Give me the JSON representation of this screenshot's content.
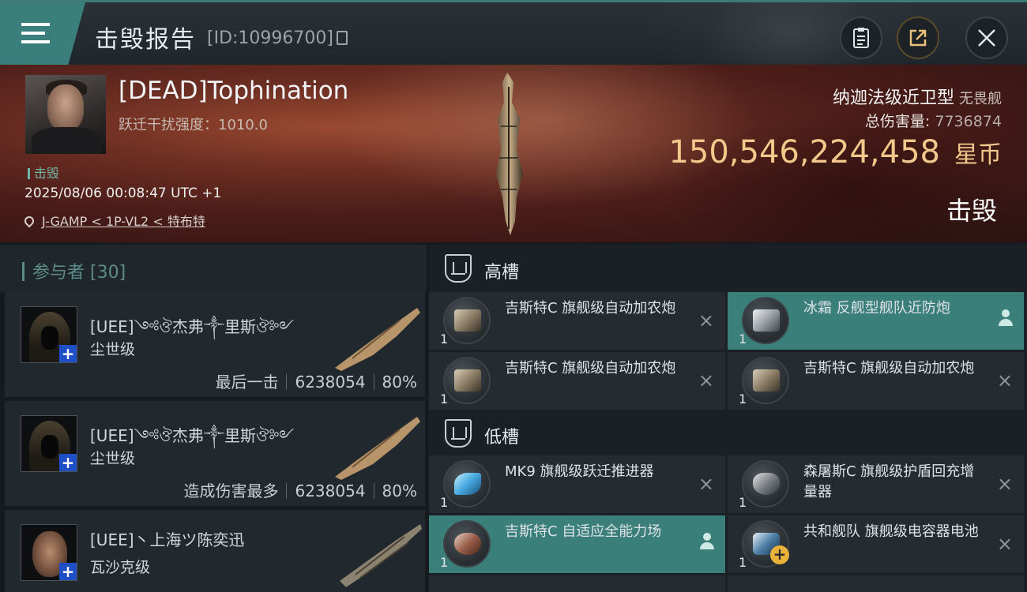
{
  "header": {
    "title": "击毁报告",
    "report_id": "[ID:10996700]",
    "icons": {
      "menu": "hamburger-menu-icon",
      "clipboard": "clipboard-icon",
      "share": "share-export-icon",
      "close": "close-icon"
    }
  },
  "banner": {
    "pilot_name": "[DEAD]Tophination",
    "warp_disruption": "跃迁干扰强度：1010.0",
    "kill_tag": "击毁",
    "datetime": "2025/08/06 00:08:47 UTC +1",
    "location": "J-GAMP < 1P-VL2 < 特布特",
    "ship_name": "纳迦法级近卫型",
    "ship_class": "无畏舰",
    "total_damage_label": "总伤害量:",
    "total_damage_value": "7736874",
    "isk_value": "150,546,224,458",
    "isk_unit": "星币",
    "result_label": "击毁"
  },
  "participants": {
    "title": "参与者 [30]",
    "items": [
      {
        "name": "[UEE]༺ঔ杰弗༒里斯ঔ༻",
        "ship": "尘世级",
        "role": "最后一击",
        "damage": "6238054",
        "percent": "80%"
      },
      {
        "name": "[UEE]༺ঔ杰弗༒里斯ঔ༻",
        "ship": "尘世级",
        "role": "造成伤害最多",
        "damage": "6238054",
        "percent": "80%"
      },
      {
        "name": "[UEE]丶上海ツ陈奕迅",
        "ship": "瓦沙克级",
        "role": "",
        "damage": "",
        "percent": ""
      }
    ]
  },
  "fitting": {
    "high_slots_title": "高槽",
    "low_slots_title": "低槽",
    "high_slots": [
      {
        "name": "吉斯特C 旗舰级自动加农炮",
        "qty": "1",
        "status": "destroyed"
      },
      {
        "name": "冰霜 反舰型舰队近防炮",
        "qty": "1",
        "status": "dropped"
      },
      {
        "name": "吉斯特C 旗舰级自动加农炮",
        "qty": "1",
        "status": "destroyed"
      },
      {
        "name": "吉斯特C 旗舰级自动加农炮",
        "qty": "1",
        "status": "destroyed"
      }
    ],
    "low_slots": [
      {
        "name": "MK9 旗舰级跃迁推进器",
        "qty": "1",
        "status": "destroyed"
      },
      {
        "name": "森屠斯C 旗舰级护盾回充增量器",
        "qty": "1",
        "status": "destroyed"
      },
      {
        "name": "吉斯特C 自适应全能力场",
        "qty": "1",
        "status": "dropped"
      },
      {
        "name": "共和舰队 旗舰级电容器电池",
        "qty": "1",
        "status": "destroyed"
      }
    ],
    "destroyed_mark": "×",
    "colors": {
      "dropped_highlight": "#3b7f7b",
      "isk_gold": "#f2c98a",
      "accent_teal": "#3a7f7c"
    }
  }
}
